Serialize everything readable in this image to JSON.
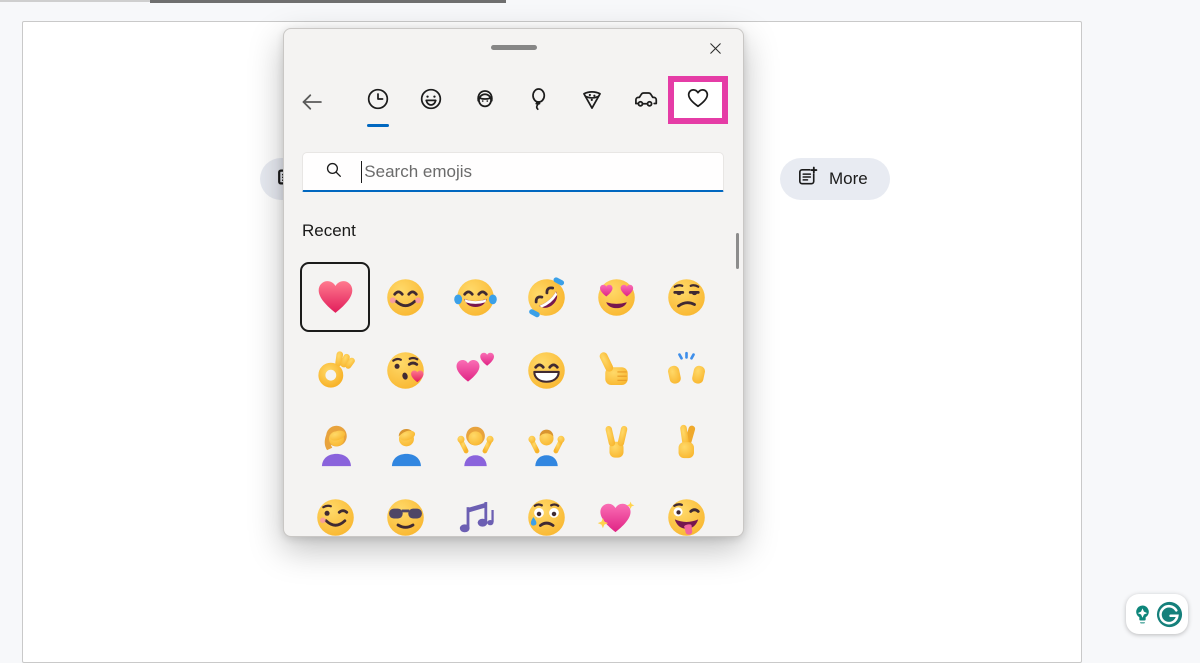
{
  "colors": {
    "accent_blue": "#0067C0",
    "highlight_magenta": "#E53CA6",
    "selected_border": "#1B1B1B",
    "pill_background": "#E8EBF2",
    "grammarly_green": "#15807B",
    "grammarly_teal": "#0E867B"
  },
  "canvas_toolbar": {
    "more_label": "More"
  },
  "emoji_picker": {
    "search": {
      "placeholder": "Search emojis",
      "value": ""
    },
    "section_title": "Recent",
    "categories": [
      {
        "name": "recent",
        "icon": "clock-icon",
        "active": true
      },
      {
        "name": "smileys",
        "icon": "smiley-icon"
      },
      {
        "name": "people",
        "icon": "person-icon"
      },
      {
        "name": "celebrations",
        "icon": "balloon-icon"
      },
      {
        "name": "food",
        "icon": "pizza-icon"
      },
      {
        "name": "vehicles",
        "icon": "car-icon"
      },
      {
        "name": "symbols",
        "icon": "heart-outline-icon",
        "highlighted": true
      }
    ],
    "emojis": [
      {
        "name": "red-heart",
        "char": "❤️",
        "icon": "heart",
        "selected": true
      },
      {
        "name": "smiling-face-with-smiling-eyes",
        "char": "😊",
        "icon": "smile"
      },
      {
        "name": "face-with-tears-of-joy",
        "char": "😂",
        "icon": "joy"
      },
      {
        "name": "rolling-on-the-floor-laughing",
        "char": "🤣",
        "icon": "rofl"
      },
      {
        "name": "smiling-face-with-heart-eyes",
        "char": "😍",
        "icon": "hearteyes"
      },
      {
        "name": "unamused-face",
        "char": "😒",
        "icon": "unamused"
      },
      {
        "name": "ok-hand",
        "char": "👌",
        "icon": "ok"
      },
      {
        "name": "face-blowing-a-kiss",
        "char": "😘",
        "icon": "kiss"
      },
      {
        "name": "two-hearts",
        "char": "💕",
        "icon": "twohearts"
      },
      {
        "name": "beaming-face-with-smiling-eyes",
        "char": "😁",
        "icon": "grin"
      },
      {
        "name": "thumbs-up",
        "char": "👍",
        "icon": "thumbsup"
      },
      {
        "name": "raising-hands",
        "char": "🙌",
        "icon": "raisinghands"
      },
      {
        "name": "woman-facepalming",
        "char": "🤦‍♀️",
        "icon": "facepalm-w"
      },
      {
        "name": "man-facepalming",
        "char": "🤦‍♂️",
        "icon": "facepalm-m"
      },
      {
        "name": "woman-shrugging",
        "char": "🤷‍♀️",
        "icon": "shrug-w"
      },
      {
        "name": "man-shrugging",
        "char": "🤷‍♂️",
        "icon": "shrug-m"
      },
      {
        "name": "victory-hand",
        "char": "✌️",
        "icon": "victory"
      },
      {
        "name": "crossed-fingers",
        "char": "🤞",
        "icon": "crossed"
      },
      {
        "name": "winking-face",
        "char": "😉",
        "icon": "wink"
      },
      {
        "name": "smiling-face-with-sunglasses",
        "char": "😎",
        "icon": "cool"
      },
      {
        "name": "musical-notes",
        "char": "🎶",
        "icon": "notes"
      },
      {
        "name": "crying-face",
        "char": "😢",
        "icon": "cry"
      },
      {
        "name": "sparkling-heart",
        "char": "💖",
        "icon": "sparkheart"
      },
      {
        "name": "winking-face-with-tongue",
        "char": "😜",
        "icon": "zany"
      }
    ]
  }
}
